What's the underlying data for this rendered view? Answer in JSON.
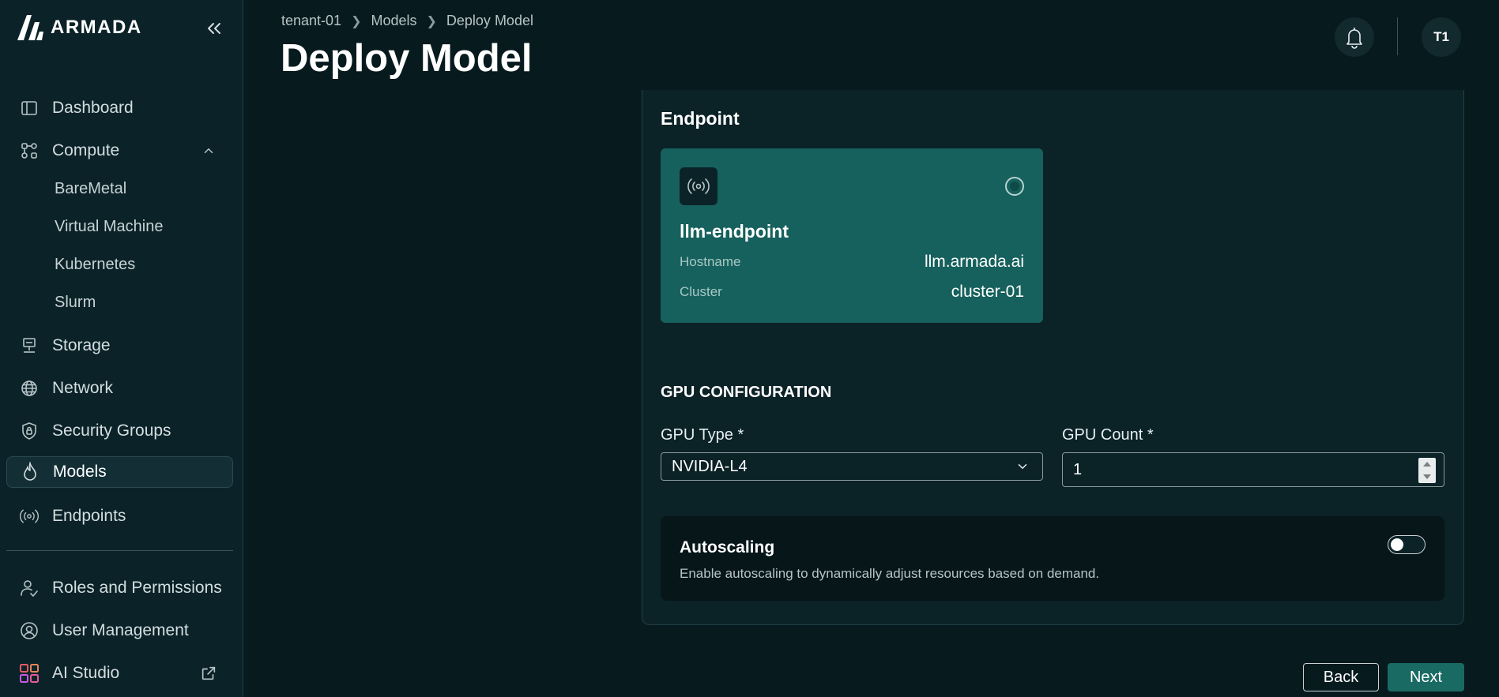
{
  "brand": {
    "name": "ARMADA"
  },
  "sidebar": {
    "items": [
      {
        "label": "Dashboard",
        "icon": "dashboard-icon"
      },
      {
        "label": "Compute",
        "icon": "compute-icon",
        "expanded": true,
        "children": [
          "BareMetal",
          "Virtual Machine",
          "Kubernetes",
          "Slurm"
        ]
      },
      {
        "label": "Storage",
        "icon": "storage-icon"
      },
      {
        "label": "Network",
        "icon": "globe-icon"
      },
      {
        "label": "Security Groups",
        "icon": "shield-lock-icon"
      },
      {
        "label": "Models",
        "icon": "flame-icon",
        "active": true
      },
      {
        "label": "Endpoints",
        "icon": "broadcast-icon"
      }
    ],
    "bottom_items": [
      {
        "label": "Roles and Permissions",
        "icon": "users-check-icon"
      },
      {
        "label": "User Management",
        "icon": "user-settings-icon"
      },
      {
        "label": "AI Studio",
        "icon": "grid-icon",
        "external": true
      }
    ]
  },
  "breadcrumb": [
    "tenant-01",
    "Models",
    "Deploy Model"
  ],
  "page": {
    "title": "Deploy Model"
  },
  "header": {
    "avatar_initials": "T1"
  },
  "endpoint_section": {
    "title": "Endpoint",
    "card": {
      "name": "llm-endpoint",
      "hostname_label": "Hostname",
      "hostname_value": "llm.armada.ai",
      "cluster_label": "Cluster",
      "cluster_value": "cluster-01",
      "selected": true
    }
  },
  "gpu": {
    "title": "GPU CONFIGURATION",
    "type_label": "GPU Type *",
    "type_value": "NVIDIA-L4",
    "count_label": "GPU Count *",
    "count_value": "1"
  },
  "autoscaling": {
    "title": "Autoscaling",
    "description": "Enable autoscaling to dynamically adjust resources based on demand.",
    "enabled": false
  },
  "actions": {
    "back": "Back",
    "next": "Next"
  },
  "colors": {
    "background": "#071a1e",
    "sidebar": "#0b2328",
    "accent": "#16615d",
    "primary_button": "#1a6a64"
  }
}
